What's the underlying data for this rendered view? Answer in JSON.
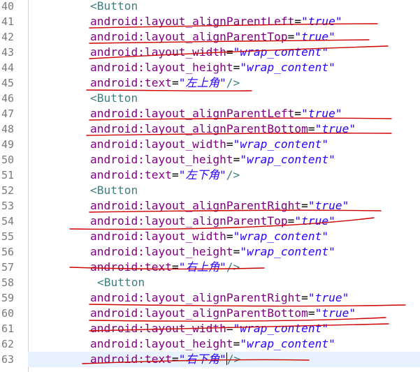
{
  "editor": {
    "lines": [
      {
        "num": "40",
        "tag": "<Button"
      },
      {
        "num": "41",
        "attr": "android:layout_alignParentLeft",
        "value": "\"true\""
      },
      {
        "num": "42",
        "attr": "android:layout_alignParentTop",
        "value": "\"true\""
      },
      {
        "num": "43",
        "attr": "android:layout_width",
        "value": "\"wrap_content\""
      },
      {
        "num": "44",
        "attr": "android:layout_height",
        "value": "\"wrap_content\""
      },
      {
        "num": "45",
        "attr": "android:text",
        "value": "\"左上角\"",
        "close": "/>"
      },
      {
        "num": "46",
        "tag": "<Button"
      },
      {
        "num": "47",
        "attr": "android:layout_alignParentLeft",
        "value": "\"true\""
      },
      {
        "num": "48",
        "attr": "android:layout_alignParentBottom",
        "value": "\"true\""
      },
      {
        "num": "49",
        "attr": "android:layout_width",
        "value": "\"wrap_content\""
      },
      {
        "num": "50",
        "attr": "android:layout_height",
        "value": "\"wrap_content\""
      },
      {
        "num": "51",
        "attr": "android:text",
        "value": "\"左下角\"",
        "close": "/>"
      },
      {
        "num": "52",
        "tag": "<Button"
      },
      {
        "num": "53",
        "attr": "android:layout_alignParentRight",
        "value": "\"true\""
      },
      {
        "num": "54",
        "attr": "android:layout_alignParentTop",
        "value": "\"true\""
      },
      {
        "num": "55",
        "attr": "android:layout_width",
        "value": "\"wrap_content\""
      },
      {
        "num": "56",
        "attr": "android:layout_height",
        "value": "\"wrap_content\""
      },
      {
        "num": "57",
        "attr": "android:text",
        "value": "\"右上角\"",
        "close": "/>"
      },
      {
        "num": "58",
        "tag": "<Button"
      },
      {
        "num": "59",
        "attr": "android:layout_alignParentRight",
        "value": "\"true\""
      },
      {
        "num": "60",
        "attr": "android:layout_alignParentBottom",
        "value": "\"true\""
      },
      {
        "num": "61",
        "attr": "android:layout_width",
        "value": "\"wrap_content\""
      },
      {
        "num": "62",
        "attr": "android:layout_height",
        "value": "\"wrap_content\""
      },
      {
        "num": "63",
        "attr": "android:text",
        "value": "\"右下角\"",
        "close": "/>",
        "current": true
      }
    ]
  },
  "colors": {
    "tag": "#3f7f7f",
    "attribute": "#7f007f",
    "string": "#2a00ff",
    "line_number": "#7a7a7a",
    "current_line": "#e8f2fe",
    "annotation": "#cc0000"
  }
}
